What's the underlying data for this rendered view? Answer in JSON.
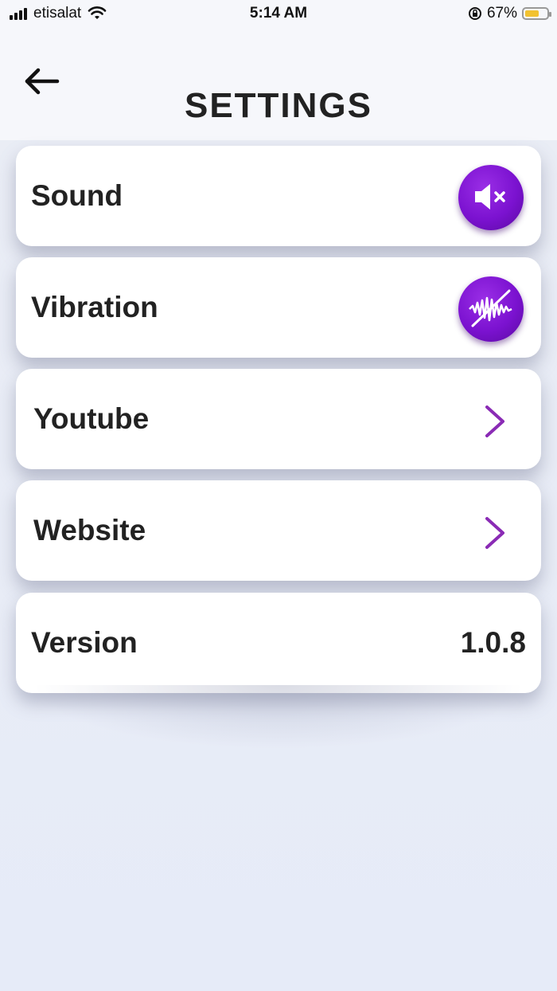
{
  "status_bar": {
    "carrier": "etisalat",
    "time": "5:14 AM",
    "battery_percent": "67%",
    "battery_level": 0.67,
    "icons": [
      "signal-icon",
      "wifi-icon",
      "orientation-lock-icon",
      "battery-icon"
    ]
  },
  "header": {
    "title": "SETTINGS",
    "back_icon": "arrow-left-icon"
  },
  "settings": {
    "sound": {
      "label": "Sound",
      "icon": "speaker-muted-icon",
      "state": "off"
    },
    "vibration": {
      "label": "Vibration",
      "icon": "vibration-off-icon",
      "state": "off"
    },
    "youtube": {
      "label": "Youtube",
      "icon": "chevron-right-icon"
    },
    "website": {
      "label": "Website",
      "icon": "chevron-right-icon"
    },
    "version": {
      "label": "Version",
      "value": "1.0.8"
    }
  },
  "colors": {
    "accent_purple": "#7b12d0",
    "chevron_purple": "#8a2bb5",
    "battery_yellow": "#f2c230",
    "text_dark": "#222222",
    "card_bg": "#ffffff"
  }
}
